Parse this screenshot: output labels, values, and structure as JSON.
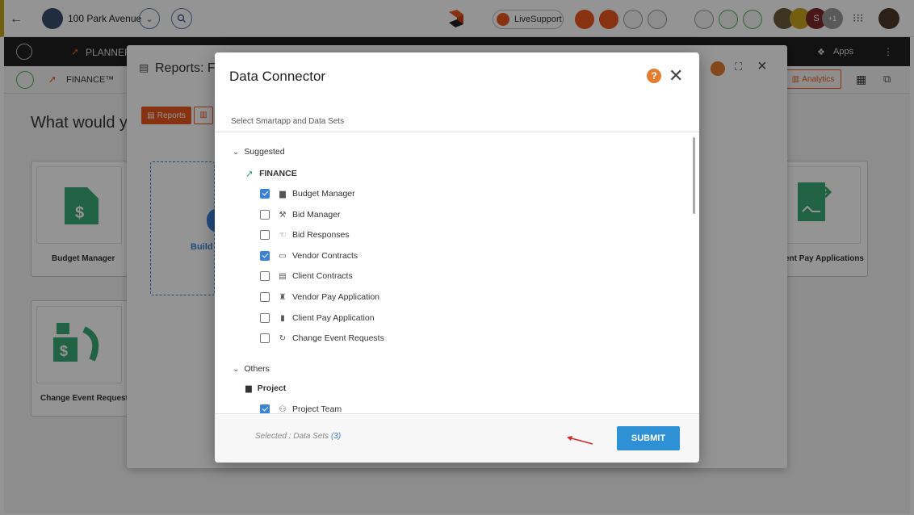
{
  "topbar": {
    "project_name": "100 Park Avenue",
    "livesupport_label": "LiveSupport",
    "avatar_initial": "S",
    "avatar_more": "+1"
  },
  "darknav": {
    "planner_label": "PLANNER",
    "apps_label": "Apps"
  },
  "subheader": {
    "module_label": "FINANCE™",
    "analytics_label": "Analytics"
  },
  "background": {
    "prompt": "What would yo",
    "cards": [
      {
        "label": "Budget Manager"
      },
      {
        "label": "Change Event Requests"
      },
      {
        "label": "ent Pay Applications"
      }
    ],
    "build_label": "Build"
  },
  "reports_modal": {
    "title": "Reports: F",
    "tab_reports": "Reports"
  },
  "dialog": {
    "title": "Data Connector",
    "subtitle": "Select Smartapp and Data Sets",
    "groups": [
      {
        "label": "Suggested",
        "apps": [
          {
            "label": "FINANCE",
            "datasets": [
              {
                "label": "Budget Manager",
                "checked": true
              },
              {
                "label": "Bid Manager",
                "checked": false
              },
              {
                "label": "Bid Responses",
                "checked": false
              },
              {
                "label": "Vendor Contracts",
                "checked": true
              },
              {
                "label": "Client Contracts",
                "checked": false
              },
              {
                "label": "Vendor Pay Application",
                "checked": false
              },
              {
                "label": "Client Pay Application",
                "checked": false
              },
              {
                "label": "Change Event Requests",
                "checked": false
              }
            ]
          }
        ]
      },
      {
        "label": "Others",
        "apps": [
          {
            "label": "Project",
            "datasets": [
              {
                "label": "Project Team",
                "checked": true
              }
            ]
          }
        ]
      }
    ],
    "footer": {
      "selected_prefix": "Selected : Data Sets",
      "selected_count": "(3)",
      "submit_label": "SUBMIT"
    }
  },
  "colors": {
    "accent": "#2e91d6",
    "checkbox": "#3b82d6",
    "brand_orange": "#e8571e",
    "help": "#e57c30",
    "finance_green": "#3aa776",
    "arrow": "#d9262c"
  }
}
